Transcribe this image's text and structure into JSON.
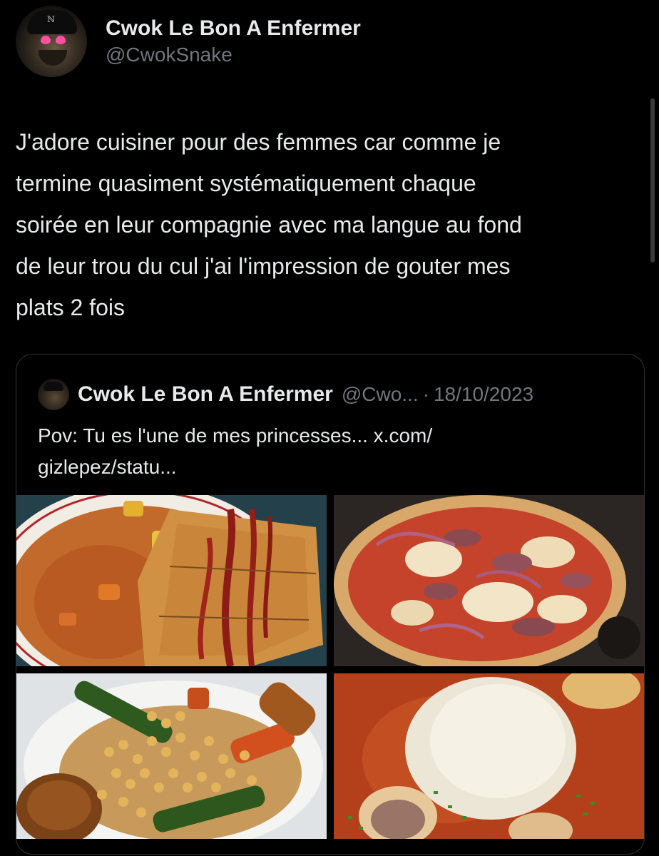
{
  "author": {
    "display_name": "Cwok Le Bon A Enfermer",
    "handle": "@CwokSnake"
  },
  "tweet": {
    "text": "J'adore cuisiner pour des femmes car comme je\ntermine quasiment systématiquement chaque\nsoirée en leur compagnie avec ma langue au fond\nde leur trou du cul j'ai l'impression de gouter mes\nplats 2 fois"
  },
  "quoted_tweet": {
    "display_name": "Cwok Le Bon A Enfermer",
    "handle": "@Cwo...",
    "separator": "·",
    "date": "18/10/2023",
    "text": "Pov: Tu es l'une de mes princesses... x.com/\ngizlepez/statu..."
  },
  "colors": {
    "background": "#000000",
    "text_primary": "#e7e9ea",
    "text_secondary": "#71767b",
    "border": "#2f3336"
  }
}
